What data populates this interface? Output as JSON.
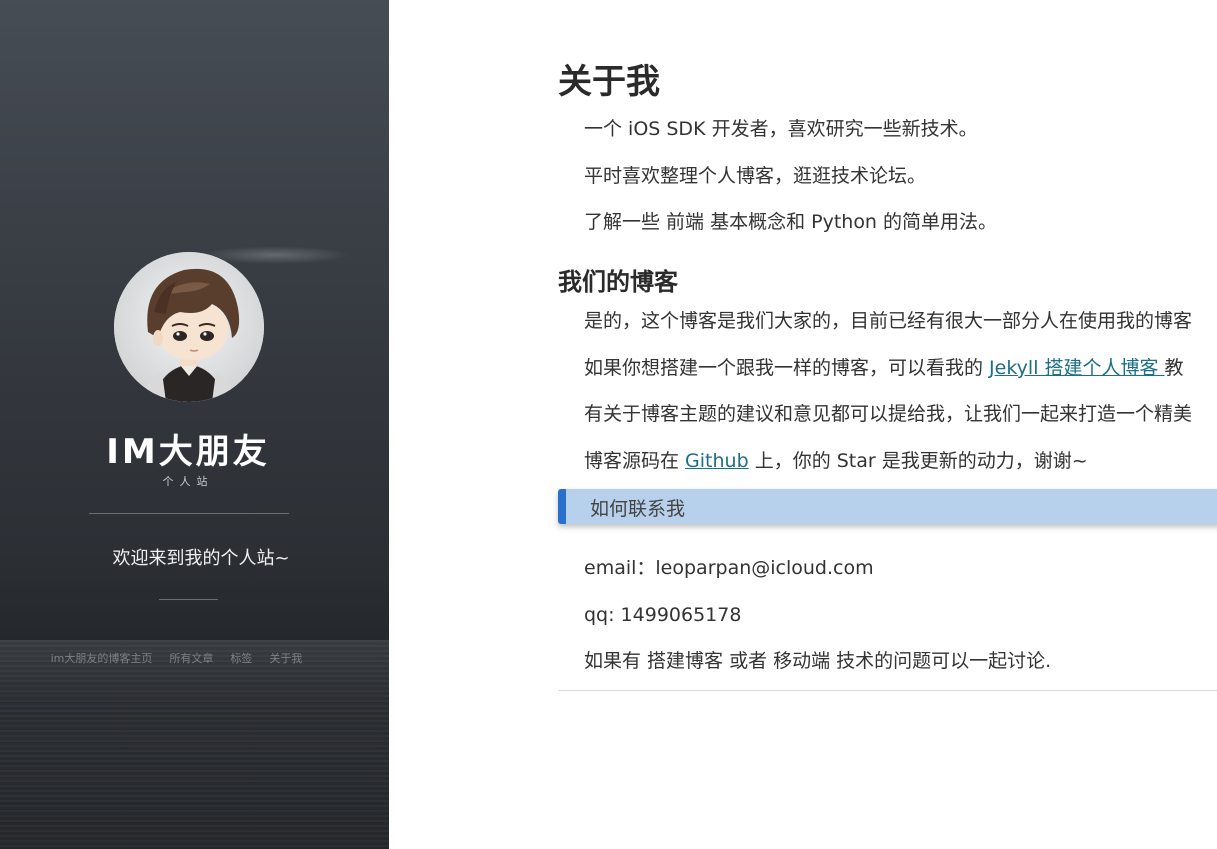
{
  "sidebar": {
    "title": "IM大朋友",
    "subtitle": "个人站",
    "welcome": "欢迎来到我的个人站~",
    "nav": [
      {
        "label": "im大朋友的博客主页"
      },
      {
        "label": "所有文章"
      },
      {
        "label": "标签"
      },
      {
        "label": "关于我"
      }
    ]
  },
  "about": {
    "heading": "关于我",
    "lines": [
      "一个 iOS SDK 开发者，喜欢研究一些新技术。",
      "平时喜欢整理个人博客，逛逛技术论坛。",
      "了解一些 前端 基本概念和 Python 的简单用法。"
    ]
  },
  "blog": {
    "heading": "我们的博客",
    "line1": "是的，这个博客是我们大家的，目前已经有很大一部分人在使用我的博客",
    "line2_pre": "如果你想搭建一个跟我一样的博客，可以看我的 ",
    "line2_link": "Jekyll 搭建个人博客 ",
    "line2_post": "教",
    "line3": "有关于博客主题的建议和意见都可以提给我，让我们一起来打造一个精美",
    "line4_pre": "博客源码在 ",
    "line4_link": "Github",
    "line4_post": " 上，你的 Star 是我更新的动力，谢谢~"
  },
  "contact": {
    "callout": "如何联系我",
    "email": "email：leoparpan@icloud.com",
    "qq": "qq: 1499065178",
    "note": "如果有 搭建博客 或者 移动端 技术的问题可以一起讨论."
  }
}
